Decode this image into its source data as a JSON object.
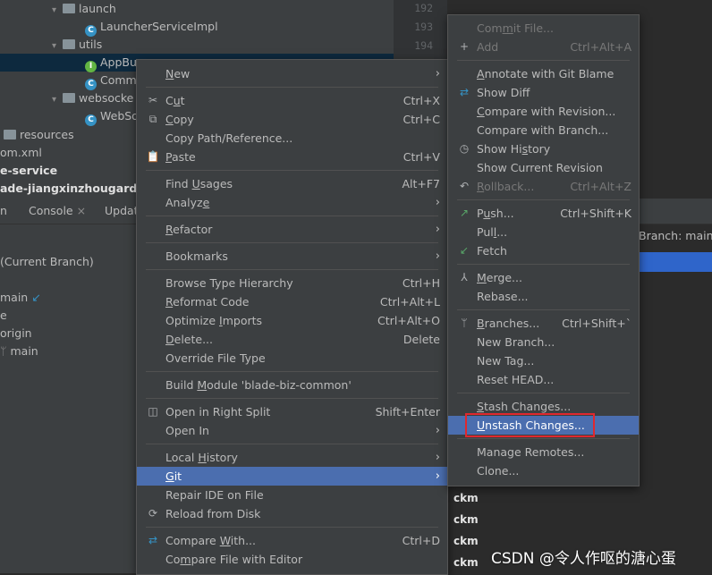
{
  "tree": {
    "rows": [
      {
        "indent": 0,
        "chev": "▾",
        "icon": "folder",
        "label": "launch"
      },
      {
        "indent": 1,
        "chev": "",
        "icon": "class",
        "label": "LauncherServiceImpl"
      },
      {
        "indent": 0,
        "chev": "▾",
        "icon": "folder",
        "label": "utils"
      },
      {
        "indent": 1,
        "chev": "",
        "icon": "interface",
        "label": "AppBu"
      },
      {
        "indent": 1,
        "chev": "",
        "icon": "class",
        "label": "Comm"
      },
      {
        "indent": 0,
        "chev": "▾",
        "icon": "folder",
        "label": "websocke"
      },
      {
        "indent": 1,
        "chev": "",
        "icon": "class",
        "label": "WebSo"
      },
      {
        "indent": -1,
        "chev": "",
        "icon": "folder",
        "label": "resources"
      },
      {
        "indent": -2,
        "chev": "",
        "icon": "",
        "label": "om.xml"
      },
      {
        "indent": -3,
        "chev": "",
        "icon": "",
        "label": "e-service"
      },
      {
        "indent": -3,
        "chev": "",
        "icon": "",
        "label": "ade-jiangxinzhougarden"
      }
    ]
  },
  "gutter": {
    "lines": [
      "192",
      "193",
      "194"
    ]
  },
  "bottom_tabs": [
    {
      "label": "n"
    },
    {
      "label": "Console",
      "closable": true
    },
    {
      "label": "Updat"
    }
  ],
  "branches": [
    {
      "label": "(Current Branch)"
    },
    {
      "label": "main",
      "icon": "arrow-icon"
    },
    {
      "label": "e"
    },
    {
      "label": "origin"
    },
    {
      "label": "main",
      "icon": "branch-icon"
    }
  ],
  "branch_status": "Branch: main",
  "commit_authors": [
    "ckm",
    "ckm",
    "ckm",
    "ckm"
  ],
  "watermark": "CSDN @令人作呕的溏心蛋",
  "context_menu": [
    {
      "type": "item",
      "label": "New",
      "mnemonic": 0,
      "arrow": true
    },
    {
      "type": "sep"
    },
    {
      "type": "item",
      "label": "Cut",
      "mnemonic": 1,
      "shortcut": "Ctrl+X",
      "icon": "✂"
    },
    {
      "type": "item",
      "label": "Copy",
      "mnemonic": 0,
      "shortcut": "Ctrl+C",
      "icon": "⧉"
    },
    {
      "type": "item",
      "label": "Copy Path/Reference...",
      "shortcut": ""
    },
    {
      "type": "item",
      "label": "Paste",
      "mnemonic": 0,
      "shortcut": "Ctrl+V",
      "icon": "📋"
    },
    {
      "type": "sep"
    },
    {
      "type": "item",
      "label": "Find Usages",
      "mnemonic": 5,
      "shortcut": "Alt+F7"
    },
    {
      "type": "item",
      "label": "Analyze",
      "mnemonic": 6,
      "arrow": true
    },
    {
      "type": "sep"
    },
    {
      "type": "item",
      "label": "Refactor",
      "mnemonic": 0,
      "arrow": true
    },
    {
      "type": "sep"
    },
    {
      "type": "item",
      "label": "Bookmarks",
      "arrow": true
    },
    {
      "type": "sep"
    },
    {
      "type": "item",
      "label": "Browse Type Hierarchy",
      "shortcut": "Ctrl+H"
    },
    {
      "type": "item",
      "label": "Reformat Code",
      "mnemonic": 0,
      "shortcut": "Ctrl+Alt+L"
    },
    {
      "type": "item",
      "label": "Optimize Imports",
      "mnemonic": 9,
      "shortcut": "Ctrl+Alt+O"
    },
    {
      "type": "item",
      "label": "Delete...",
      "mnemonic": 0,
      "shortcut": "Delete"
    },
    {
      "type": "item",
      "label": "Override File Type"
    },
    {
      "type": "sep"
    },
    {
      "type": "item",
      "label": "Build Module 'blade-biz-common'",
      "mnemonic": 6
    },
    {
      "type": "sep"
    },
    {
      "type": "item",
      "label": "Open in Right Split",
      "shortcut": "Shift+Enter",
      "icon": "◫"
    },
    {
      "type": "item",
      "label": "Open In",
      "arrow": true
    },
    {
      "type": "sep"
    },
    {
      "type": "item",
      "label": "Local History",
      "mnemonic": 6,
      "arrow": true
    },
    {
      "type": "item",
      "label": "Git",
      "mnemonic": 0,
      "arrow": true,
      "highlighted": true
    },
    {
      "type": "item",
      "label": "Repair IDE on File"
    },
    {
      "type": "item",
      "label": "Reload from Disk",
      "icon": "⟳"
    },
    {
      "type": "sep"
    },
    {
      "type": "item",
      "label": "Compare With...",
      "mnemonic": 8,
      "shortcut": "Ctrl+D",
      "icon": "⇄"
    },
    {
      "type": "item",
      "label": "Compare File with Editor",
      "mnemonic": 2
    }
  ],
  "git_menu": [
    {
      "type": "item",
      "label": "Commit File...",
      "mnemonic": 3,
      "disabled": true
    },
    {
      "type": "item",
      "label": "Add",
      "shortcut": "Ctrl+Alt+A",
      "disabled": true,
      "icon": "+"
    },
    {
      "type": "sep"
    },
    {
      "type": "item",
      "label": "Annotate with Git Blame",
      "mnemonic": 0
    },
    {
      "type": "item",
      "label": "Show Diff",
      "icon": "⇄"
    },
    {
      "type": "item",
      "label": "Compare with Revision...",
      "mnemonic": 0
    },
    {
      "type": "item",
      "label": "Compare with Branch..."
    },
    {
      "type": "item",
      "label": "Show History",
      "mnemonic": 7,
      "icon": "◷"
    },
    {
      "type": "item",
      "label": "Show Current Revision"
    },
    {
      "type": "item",
      "label": "Rollback...",
      "mnemonic": 0,
      "shortcut": "Ctrl+Alt+Z",
      "disabled": true,
      "icon": "↶"
    },
    {
      "type": "sep"
    },
    {
      "type": "item",
      "label": "Push...",
      "mnemonic": 1,
      "shortcut": "Ctrl+Shift+K",
      "icon": "↗"
    },
    {
      "type": "item",
      "label": "Pull...",
      "mnemonic": 3
    },
    {
      "type": "item",
      "label": "Fetch",
      "icon": "↙"
    },
    {
      "type": "sep"
    },
    {
      "type": "item",
      "label": "Merge...",
      "mnemonic": 0,
      "icon": "⅄"
    },
    {
      "type": "item",
      "label": "Rebase..."
    },
    {
      "type": "sep"
    },
    {
      "type": "item",
      "label": "Branches...",
      "mnemonic": 0,
      "shortcut": "Ctrl+Shift+`",
      "icon": "ᛘ"
    },
    {
      "type": "item",
      "label": "New Branch..."
    },
    {
      "type": "item",
      "label": "New Tag..."
    },
    {
      "type": "item",
      "label": "Reset HEAD..."
    },
    {
      "type": "sep"
    },
    {
      "type": "item",
      "label": "Stash Changes...",
      "mnemonic": 0
    },
    {
      "type": "item",
      "label": "Unstash Changes...",
      "mnemonic": 0,
      "highlighted": true
    },
    {
      "type": "sep"
    },
    {
      "type": "item",
      "label": "Manage Remotes..."
    },
    {
      "type": "item",
      "label": "Clone..."
    }
  ]
}
